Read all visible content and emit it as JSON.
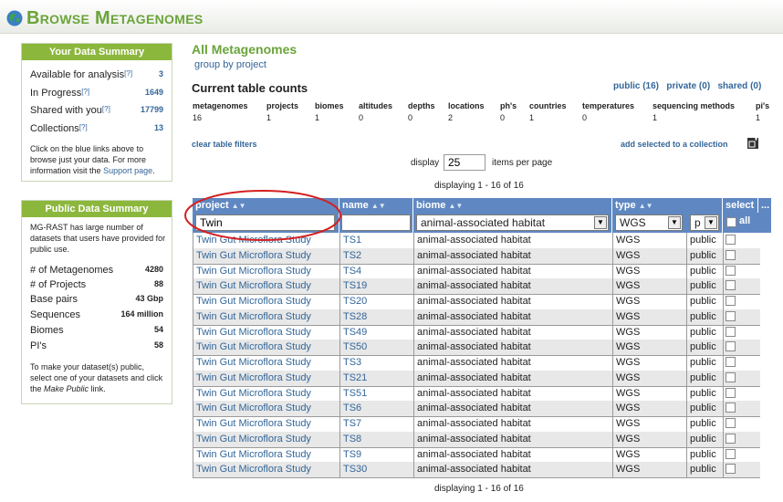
{
  "header": {
    "title": "Browse Metagenomes"
  },
  "your_summary": {
    "title": "Your Data Summary",
    "items": [
      {
        "label": "Available for analysis",
        "value": "3"
      },
      {
        "label": "In Progress",
        "value": "1649"
      },
      {
        "label": "Shared with you",
        "value": "17799"
      },
      {
        "label": "Collections",
        "value": "13"
      }
    ],
    "help_marker": "[?]",
    "note_pre": "Click on the blue links above to browse just your data. For more information visit the",
    "note_link": "Support page",
    "note_end": "."
  },
  "public_summary": {
    "title": "Public Data Summary",
    "intro": "MG-RAST has large number of datasets that users have provided for public use.",
    "items": [
      {
        "label": "# of Metagenomes",
        "value": "4280"
      },
      {
        "label": "# of Projects",
        "value": "88"
      },
      {
        "label": "Base pairs",
        "value": "43 Gbp"
      },
      {
        "label": "Sequences",
        "value": "164 million"
      },
      {
        "label": "Biomes",
        "value": "54"
      },
      {
        "label": "PI's",
        "value": "58"
      }
    ],
    "note_a": "To make your dataset(s) public, select one of your datasets and click the",
    "note_em": "Make Public",
    "note_b": "link."
  },
  "main": {
    "title": "All Metagenomes",
    "group_by": "group by project",
    "counts_title": "Current table counts",
    "filters": {
      "public": "public (16)",
      "private": "private (0)",
      "shared": "shared (0)"
    },
    "counts": [
      {
        "label": "metagenomes",
        "value": "16"
      },
      {
        "label": "projects",
        "value": "1"
      },
      {
        "label": "biomes",
        "value": "1"
      },
      {
        "label": "altitudes",
        "value": "0"
      },
      {
        "label": "depths",
        "value": "0"
      },
      {
        "label": "locations",
        "value": "2"
      },
      {
        "label": "ph's",
        "value": "0"
      },
      {
        "label": "countries",
        "value": "1"
      },
      {
        "label": "temperatures",
        "value": "0"
      },
      {
        "label": "sequencing methods",
        "value": "1"
      },
      {
        "label": "pi's",
        "value": "1"
      }
    ],
    "clear_filters": "clear table filters",
    "add_selected": "add selected to a collection",
    "display_label": "display",
    "items_per_page": "25",
    "items_label": "items per page",
    "displaying": "displaying 1 - 16 of 16"
  },
  "table": {
    "headers": {
      "project": "project",
      "name": "name",
      "biome": "biome",
      "type": "type",
      "select": "select",
      "more": "..."
    },
    "filters": {
      "project": "Twin",
      "name": "",
      "biome": "animal-associated habitat",
      "type": "WGS",
      "visibility": "p",
      "select_all": "all"
    },
    "rows": [
      {
        "project": "Twin Gut Microflora Study",
        "name": "TS1",
        "biome": "animal-associated habitat",
        "type": "WGS",
        "vis": "public"
      },
      {
        "project": "Twin Gut Microflora Study",
        "name": "TS2",
        "biome": "animal-associated habitat",
        "type": "WGS",
        "vis": "public"
      },
      {
        "project": "Twin Gut Microflora Study",
        "name": "TS4",
        "biome": "animal-associated habitat",
        "type": "WGS",
        "vis": "public"
      },
      {
        "project": "Twin Gut Microflora Study",
        "name": "TS19",
        "biome": "animal-associated habitat",
        "type": "WGS",
        "vis": "public"
      },
      {
        "project": "Twin Gut Microflora Study",
        "name": "TS20",
        "biome": "animal-associated habitat",
        "type": "WGS",
        "vis": "public"
      },
      {
        "project": "Twin Gut Microflora Study",
        "name": "TS28",
        "biome": "animal-associated habitat",
        "type": "WGS",
        "vis": "public"
      },
      {
        "project": "Twin Gut Microflora Study",
        "name": "TS49",
        "biome": "animal-associated habitat",
        "type": "WGS",
        "vis": "public"
      },
      {
        "project": "Twin Gut Microflora Study",
        "name": "TS50",
        "biome": "animal-associated habitat",
        "type": "WGS",
        "vis": "public"
      },
      {
        "project": "Twin Gut Microflora Study",
        "name": "TS3",
        "biome": "animal-associated habitat",
        "type": "WGS",
        "vis": "public"
      },
      {
        "project": "Twin Gut Microflora Study",
        "name": "TS21",
        "biome": "animal-associated habitat",
        "type": "WGS",
        "vis": "public"
      },
      {
        "project": "Twin Gut Microflora Study",
        "name": "TS51",
        "biome": "animal-associated habitat",
        "type": "WGS",
        "vis": "public"
      },
      {
        "project": "Twin Gut Microflora Study",
        "name": "TS6",
        "biome": "animal-associated habitat",
        "type": "WGS",
        "vis": "public"
      },
      {
        "project": "Twin Gut Microflora Study",
        "name": "TS7",
        "biome": "animal-associated habitat",
        "type": "WGS",
        "vis": "public"
      },
      {
        "project": "Twin Gut Microflora Study",
        "name": "TS8",
        "biome": "animal-associated habitat",
        "type": "WGS",
        "vis": "public"
      },
      {
        "project": "Twin Gut Microflora Study",
        "name": "TS9",
        "biome": "animal-associated habitat",
        "type": "WGS",
        "vis": "public"
      },
      {
        "project": "Twin Gut Microflora Study",
        "name": "TS30",
        "biome": "animal-associated habitat",
        "type": "WGS",
        "vis": "public"
      }
    ]
  },
  "colors": {
    "brand_green": "#6aa43a",
    "box_header": "#8cb73d",
    "table_header": "#5f88c2",
    "link": "#336699",
    "annotation_circle": "#d42020"
  },
  "icons": {
    "logo": "globe-icon",
    "sort": "sort-arrows-icon",
    "dropdown": "dropdown-arrow-icon",
    "collection": "collection-icon"
  }
}
